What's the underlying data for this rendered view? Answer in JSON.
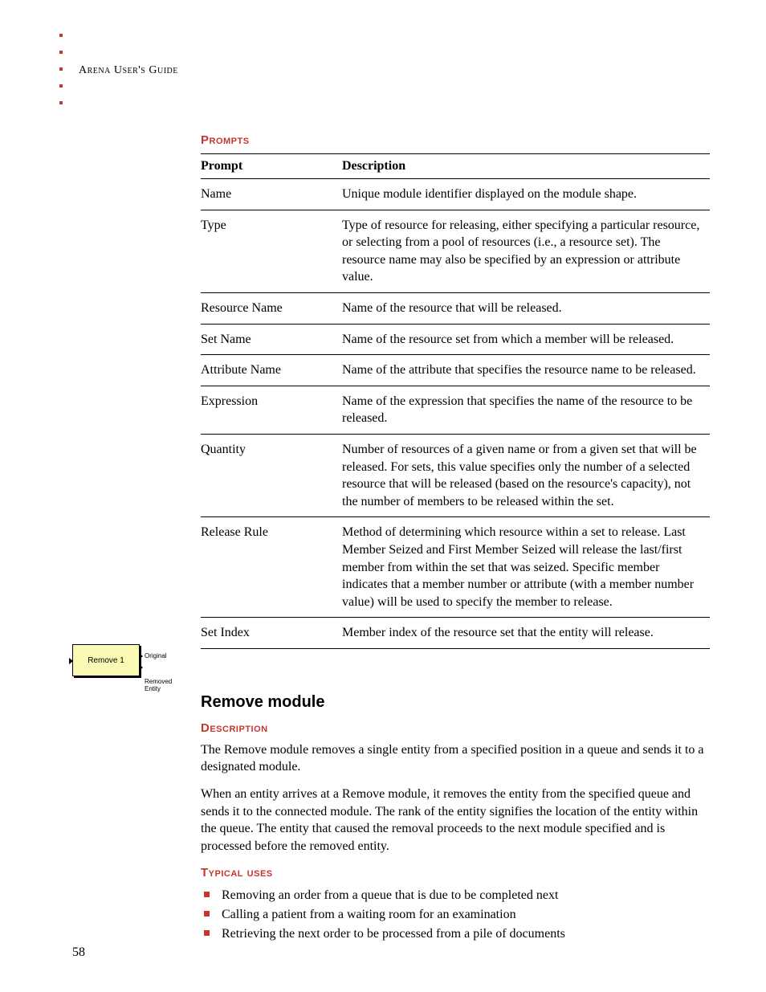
{
  "header": "Arena User's Guide",
  "pageNumber": "58",
  "promptsHeading": "Prompts",
  "tableHeaders": {
    "col1": "Prompt",
    "col2": "Description"
  },
  "rows": [
    {
      "prompt": "Name",
      "desc": "Unique module identifier displayed on the module shape."
    },
    {
      "prompt": "Type",
      "desc": "Type of resource for releasing, either specifying a particular resource, or selecting from a pool of resources (i.e., a resource set). The resource name may also be specified by an expression or attribute value."
    },
    {
      "prompt": "Resource Name",
      "desc": "Name of the resource that will be released."
    },
    {
      "prompt": "Set Name",
      "desc": "Name of the resource set from which a member will be released."
    },
    {
      "prompt": "Attribute Name",
      "desc": "Name of the attribute that specifies the resource name to be released."
    },
    {
      "prompt": "Expression",
      "desc": "Name of the expression that specifies the name of the resource to be released."
    },
    {
      "prompt": "Quantity",
      "desc": "Number of resources of a given name or from a given set that will be released. For sets, this value specifies only the number of a selected resource that will be released (based on the resource's capacity), not the number of members to be released within the set."
    },
    {
      "prompt": "Release Rule",
      "desc": "Method of determining which resource within a set to release. Last Member Seized and First Member Seized will release the last/first member from within the set that was seized. Specific member indicates that a member number or attribute (with a member number value) will be used to specify the member to release."
    },
    {
      "prompt": "Set Index",
      "desc": "Member index of the resource set that the entity will release."
    }
  ],
  "moduleTitle": "Remove module",
  "descHeading": "Description",
  "descPara1": "The Remove module removes a single entity from a specified position in a queue and sends it to a designated module.",
  "descPara2": "When an entity arrives at a Remove module, it removes the entity from the specified queue and sends it to the connected module. The rank of the entity signifies the location of the entity within the queue. The entity that caused the removal proceeds to the next module specified and is processed before the removed entity.",
  "usesHeading": "Typical uses",
  "uses": [
    "Removing an order from a queue that is due to be completed next",
    "Calling a patient from a waiting room for an examination",
    "Retrieving the next order to be processed from a pile of documents"
  ],
  "diagram": {
    "boxLabel": "Remove 1",
    "label1": "Original",
    "label2": "Removed Entity"
  }
}
